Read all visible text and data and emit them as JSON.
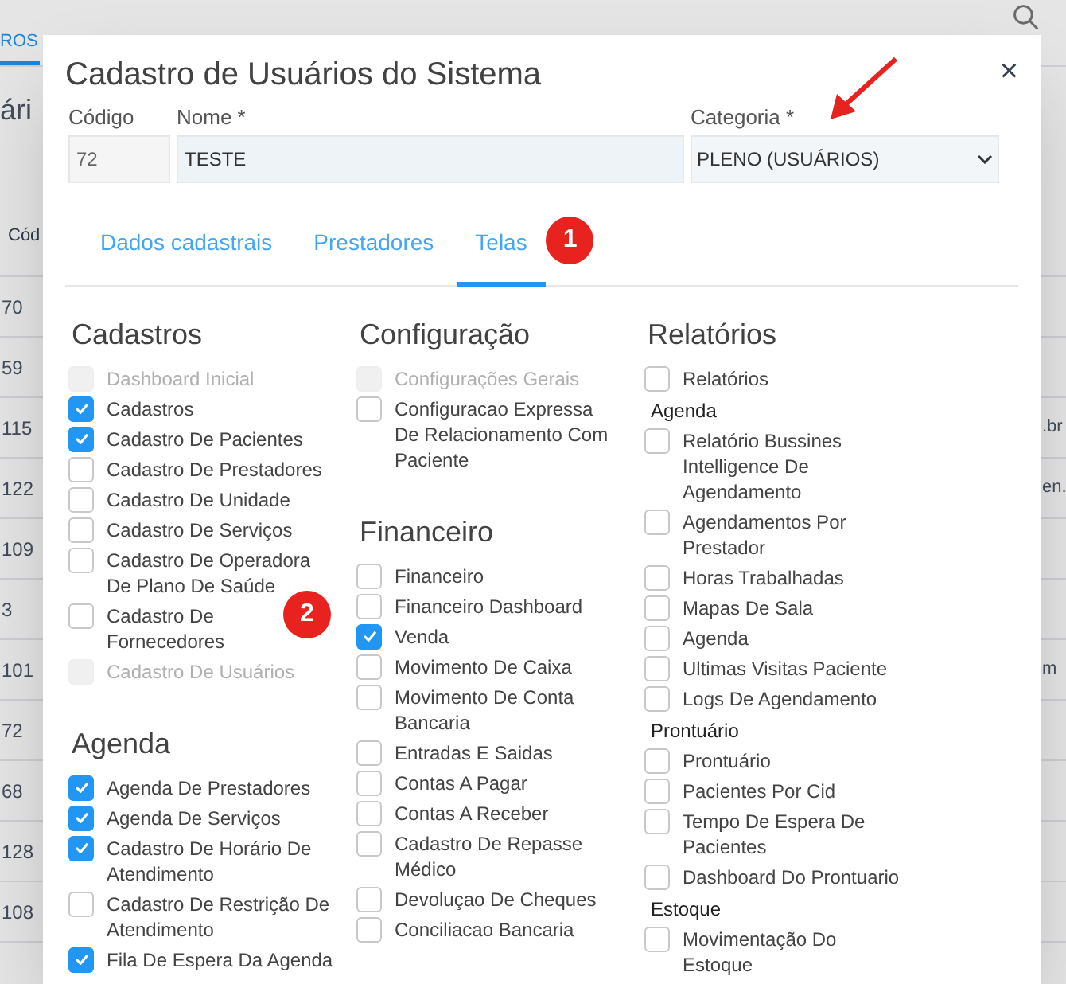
{
  "background": {
    "tab": "ROS",
    "heading": "ári",
    "column_header": "Cód",
    "rows": [
      {
        "code": "70"
      },
      {
        "code": "59"
      },
      {
        "code": "115",
        "tail": ".br"
      },
      {
        "code": "122",
        "tail": "en."
      },
      {
        "code": "109"
      },
      {
        "code": "3"
      },
      {
        "code": "101",
        "tail": "m"
      },
      {
        "code": "72"
      },
      {
        "code": "68"
      },
      {
        "code": "128"
      },
      {
        "code": "108"
      }
    ]
  },
  "dialog": {
    "title": "Cadastro de Usuários do Sistema",
    "close": "×",
    "fields": [
      {
        "kind": "text",
        "label": "Código",
        "value": "72",
        "disabled": true
      },
      {
        "kind": "text",
        "label": "Nome *",
        "value": "TESTE",
        "disabled": false
      },
      {
        "kind": "select",
        "label": "Categoria *",
        "value": "PLENO (USUÁRIOS)",
        "pointer": true
      }
    ],
    "tabs": [
      {
        "label": "Dados cadastrais",
        "selected": false
      },
      {
        "label": "Prestadores",
        "selected": false
      },
      {
        "label": "Telas",
        "selected": true,
        "badge": "1"
      }
    ],
    "columns": [
      {
        "sections": [
          {
            "title": "Cadastros",
            "items": [
              {
                "kind": "check",
                "label": "Dashboard Inicial",
                "checked": false,
                "disabled": true
              },
              {
                "kind": "check",
                "label": "Cadastros",
                "checked": true,
                "disabled": false
              },
              {
                "kind": "check",
                "label": "Cadastro De Pacientes",
                "checked": true,
                "disabled": false
              },
              {
                "kind": "check",
                "label": "Cadastro De Prestadores",
                "checked": false,
                "disabled": false
              },
              {
                "kind": "check",
                "label": "Cadastro De Unidade",
                "checked": false,
                "disabled": false
              },
              {
                "kind": "check",
                "label": "Cadastro De Serviços",
                "checked": false,
                "disabled": false
              },
              {
                "kind": "check",
                "label": "Cadastro De Operadora De Plano De Saúde",
                "checked": false,
                "disabled": false
              },
              {
                "kind": "check",
                "label": "Cadastro De Fornecedores",
                "checked": false,
                "disabled": false,
                "badge": "2"
              },
              {
                "kind": "check",
                "label": "Cadastro De Usuários",
                "checked": false,
                "disabled": true
              }
            ]
          },
          {
            "title": "Agenda",
            "items": [
              {
                "kind": "check",
                "label": "Agenda De Prestadores",
                "checked": true,
                "disabled": false
              },
              {
                "kind": "check",
                "label": "Agenda De Serviços",
                "checked": true,
                "disabled": false
              },
              {
                "kind": "check",
                "label": "Cadastro De Horário De Atendimento",
                "checked": true,
                "disabled": false
              },
              {
                "kind": "check",
                "label": "Cadastro De Restrição De Atendimento",
                "checked": false,
                "disabled": false
              },
              {
                "kind": "check",
                "label": "Fila De Espera Da Agenda",
                "checked": true,
                "disabled": false
              }
            ]
          }
        ]
      },
      {
        "sections": [
          {
            "title": "Configuração",
            "items": [
              {
                "kind": "check",
                "label": "Configurações Gerais",
                "checked": false,
                "disabled": true
              },
              {
                "kind": "check",
                "label": "Configuracao Expressa De Relacionamento Com Paciente",
                "checked": false,
                "disabled": false
              }
            ]
          },
          {
            "title": "Financeiro",
            "items": [
              {
                "kind": "check",
                "label": "Financeiro",
                "checked": false,
                "disabled": false
              },
              {
                "kind": "check",
                "label": "Financeiro Dashboard",
                "checked": false,
                "disabled": false
              },
              {
                "kind": "check",
                "label": "Venda",
                "checked": true,
                "disabled": false
              },
              {
                "kind": "check",
                "label": "Movimento De Caixa",
                "checked": false,
                "disabled": false
              },
              {
                "kind": "check",
                "label": "Movimento De Conta Bancaria",
                "checked": false,
                "disabled": false
              },
              {
                "kind": "check",
                "label": "Entradas E Saidas",
                "checked": false,
                "disabled": false
              },
              {
                "kind": "check",
                "label": "Contas A Pagar",
                "checked": false,
                "disabled": false
              },
              {
                "kind": "check",
                "label": "Contas A Receber",
                "checked": false,
                "disabled": false
              },
              {
                "kind": "check",
                "label": "Cadastro De Repasse Médico",
                "checked": false,
                "disabled": false
              },
              {
                "kind": "check",
                "label": "Devoluçao De Cheques",
                "checked": false,
                "disabled": false
              },
              {
                "kind": "check",
                "label": "Conciliacao Bancaria",
                "checked": false,
                "disabled": false
              }
            ]
          }
        ]
      },
      {
        "sections": [
          {
            "title": "Relatórios",
            "items": [
              {
                "kind": "check",
                "label": "Relatórios",
                "checked": false,
                "disabled": false
              },
              {
                "kind": "subheading",
                "label": "Agenda"
              },
              {
                "kind": "check",
                "label": "Relatório Bussines Intelligence De Agendamento",
                "checked": false,
                "disabled": false
              },
              {
                "kind": "check",
                "label": "Agendamentos Por Prestador",
                "checked": false,
                "disabled": false
              },
              {
                "kind": "check",
                "label": "Horas Trabalhadas",
                "checked": false,
                "disabled": false
              },
              {
                "kind": "check",
                "label": "Mapas De Sala",
                "checked": false,
                "disabled": false
              },
              {
                "kind": "check",
                "label": "Agenda",
                "checked": false,
                "disabled": false
              },
              {
                "kind": "check",
                "label": "Ultimas Visitas Paciente",
                "checked": false,
                "disabled": false
              },
              {
                "kind": "check",
                "label": "Logs De Agendamento",
                "checked": false,
                "disabled": false
              },
              {
                "kind": "subheading",
                "label": "Prontuário"
              },
              {
                "kind": "check",
                "label": "Prontuário",
                "checked": false,
                "disabled": false
              },
              {
                "kind": "check",
                "label": "Pacientes Por Cid",
                "checked": false,
                "disabled": false
              },
              {
                "kind": "check",
                "label": "Tempo De Espera De Pacientes",
                "checked": false,
                "disabled": false
              },
              {
                "kind": "check",
                "label": "Dashboard Do Prontuario",
                "checked": false,
                "disabled": false
              },
              {
                "kind": "subheading",
                "label": "Estoque"
              },
              {
                "kind": "check",
                "label": "Movimentação Do Estoque",
                "checked": false,
                "disabled": false
              }
            ]
          }
        ]
      }
    ]
  }
}
